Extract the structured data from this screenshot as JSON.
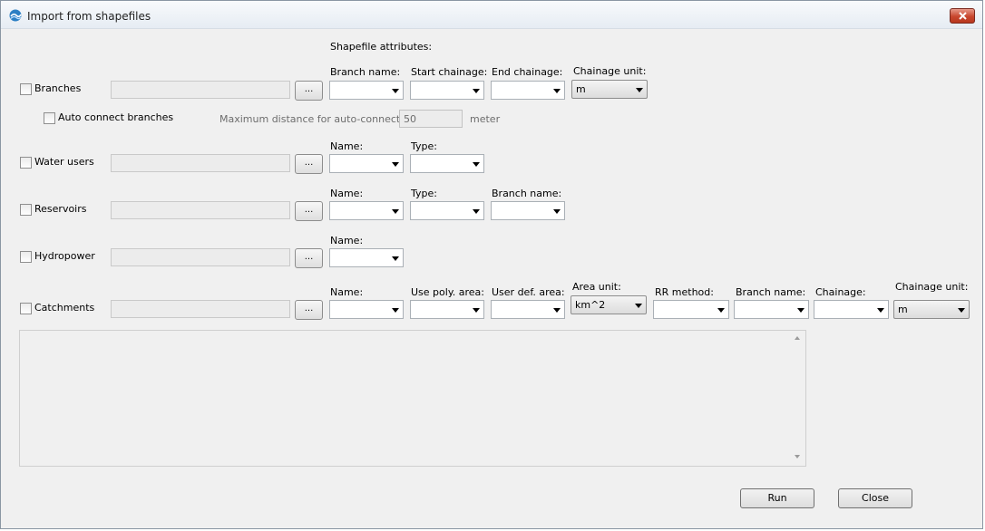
{
  "window": {
    "title": "Import from shapefiles"
  },
  "header": {
    "shapefile_attributes": "Shapefile attributes:"
  },
  "browse_label": "...",
  "branches": {
    "label": "Branches",
    "columns": [
      "Branch name:",
      "Start chainage:",
      "End chainage:",
      "Chainage unit:"
    ],
    "chainage_unit_value": "m",
    "auto_connect_label": "Auto connect branches",
    "max_distance_label": "Maximum distance for auto-connection:",
    "max_distance_value": "50",
    "max_distance_unit": "meter"
  },
  "water_users": {
    "label": "Water users",
    "columns": [
      "Name:",
      "Type:"
    ]
  },
  "reservoirs": {
    "label": "Reservoirs",
    "columns": [
      "Name:",
      "Type:",
      "Branch name:"
    ]
  },
  "hydropower": {
    "label": "Hydropower",
    "columns": [
      "Name:"
    ]
  },
  "catchments": {
    "label": "Catchments",
    "columns": [
      "Name:",
      "Use poly. area:",
      "User def. area:",
      "Area unit:",
      "RR method:",
      "Branch name:",
      "Chainage:",
      "Chainage unit:"
    ],
    "area_unit_value": "km^2",
    "chainage_unit_value": "m"
  },
  "buttons": {
    "run": "Run",
    "close": "Close"
  }
}
